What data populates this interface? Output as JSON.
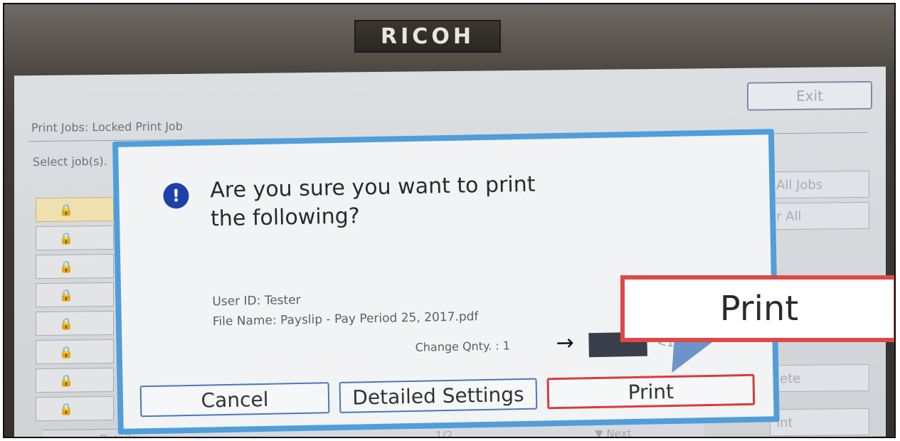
{
  "device": {
    "brand": "RICOH"
  },
  "background_screen": {
    "title": "Print Jobs: Locked Print Job",
    "instruction": "Select job(s).",
    "exit_label": "Exit",
    "side_buttons": [
      "All Jobs",
      "r All",
      "lete",
      "int"
    ],
    "page_indicator": "1/2",
    "bottom_left_label": "Details",
    "bottom_next_label": "▼ Next"
  },
  "dialog": {
    "question_line1": "Are you sure you want to print",
    "question_line2": "the following?",
    "user_id": "User ID: Tester",
    "file_name": "File Name: Payslip - Pay Period 25, 2017.pdf",
    "change_qty": "Change Qnty. : 1",
    "qty_range": "<1 - 9>",
    "buttons": {
      "cancel": "Cancel",
      "detailed_settings": "Detailed Settings",
      "print": "Print"
    },
    "icon": "info-exclamation-icon"
  },
  "callout": {
    "label": "Print",
    "highlight_color": "#e04848",
    "pointer_color": "#6c94c8"
  }
}
